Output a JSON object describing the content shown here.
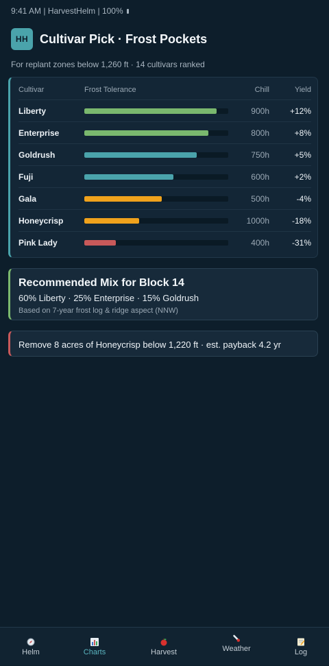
{
  "status_bar": {
    "text": "9:41 AM | HarvestHelm | 100%"
  },
  "header": {
    "logo_text": "HH",
    "title": "Cultivar Pick · Frost Pockets",
    "subtitle": "For replant zones below 1,260 ft · 14 cultivars ranked"
  },
  "table": {
    "headers": {
      "cultivar": "Cultivar",
      "frost_tolerance": "Frost Tolerance",
      "chill": "Chill",
      "yield": "Yield"
    },
    "rows": [
      {
        "name": "Liberty",
        "tolerance": 0.92,
        "color": "#7ab86e",
        "chill": "900h",
        "yield": "+12%"
      },
      {
        "name": "Enterprise",
        "tolerance": 0.86,
        "color": "#7ab86e",
        "chill": "800h",
        "yield": "+8%"
      },
      {
        "name": "Goldrush",
        "tolerance": 0.78,
        "color": "#4aa3ab",
        "chill": "750h",
        "yield": "+5%"
      },
      {
        "name": "Fuji",
        "tolerance": 0.62,
        "color": "#4aa3ab",
        "chill": "600h",
        "yield": "+2%"
      },
      {
        "name": "Gala",
        "tolerance": 0.54,
        "color": "#f0a21c",
        "chill": "500h",
        "yield": "-4%"
      },
      {
        "name": "Honeycrisp",
        "tolerance": 0.38,
        "color": "#f0a21c",
        "chill": "1000h",
        "yield": "-18%"
      },
      {
        "name": "Pink Lady",
        "tolerance": 0.22,
        "color": "#c8595a",
        "chill": "400h",
        "yield": "-31%"
      }
    ]
  },
  "recommendation": {
    "title": "Recommended Mix for Block 14",
    "mix": "60% Liberty · 25% Enterprise · 15% Goldrush",
    "note": "Based on 7-year frost log & ridge aspect (NNW)",
    "accent": "#7ab86e"
  },
  "alert": {
    "text": "Remove 8 acres of Honeycrisp below 1,220 ft · est. payback 4.2 yr",
    "accent": "#c8595a"
  },
  "tabs": [
    {
      "label": "Helm",
      "icon": "compass-icon",
      "active": false
    },
    {
      "label": "Charts",
      "icon": "bar-chart-icon",
      "active": true
    },
    {
      "label": "Harvest",
      "icon": "apple-icon",
      "active": false
    },
    {
      "label": "Weather",
      "icon": "thermometer-icon",
      "active": false
    },
    {
      "label": "Log",
      "icon": "memo-icon",
      "active": false
    }
  ],
  "colors": {
    "background": "#0d1e2b",
    "card": "#132636",
    "accent_teal": "#4aa3ab",
    "active_tab": "#5bb5c0"
  }
}
